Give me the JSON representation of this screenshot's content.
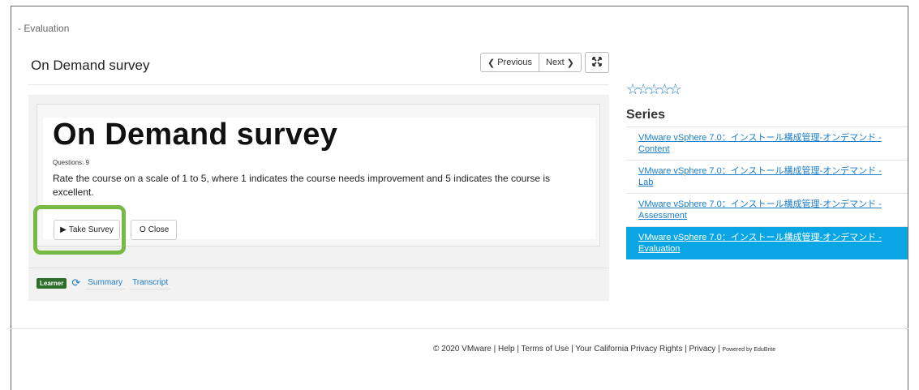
{
  "breadcrumb": "- Evaluation",
  "panel": {
    "title": "On Demand survey",
    "previous_label": "Previous",
    "next_label": "Next"
  },
  "survey": {
    "title": "On Demand survey",
    "questions": "Questions: 9",
    "description": "Rate the course on a scale of 1 to 5, where 1 indicates the course needs improvement and 5 indicates the course is excellent.",
    "take_label": "Take Survey",
    "close_label": "Close"
  },
  "footer_bar": {
    "badge": "Learner",
    "summary": "Summary",
    "transcript": "Transcript"
  },
  "sidebar": {
    "rating_stars": "☆☆☆☆☆",
    "series_title": "Series",
    "items": [
      {
        "label": "VMware vSphere 7.0：インストール構成管理-オンデマンド - Content",
        "active": false
      },
      {
        "label": "VMware vSphere 7.0：インストール構成管理-オンデマンド - Lab",
        "active": false
      },
      {
        "label": "VMware vSphere 7.0：インストール構成管理-オンデマンド - Assessment",
        "active": false
      },
      {
        "label": "VMware vSphere 7.0：インストール構成管理-オンデマンド - Evaluation",
        "active": true
      }
    ]
  },
  "page_footer": {
    "text": "© 2020 VMware | Help | Terms of Use | Your California Privacy Rights | Privacy |",
    "powered": "Powered by EduBrite"
  },
  "colors": {
    "accent": "#1c7dc8",
    "active_item": "#0aa6e4",
    "highlight": "#78b943",
    "badge": "#2d6e2a"
  }
}
